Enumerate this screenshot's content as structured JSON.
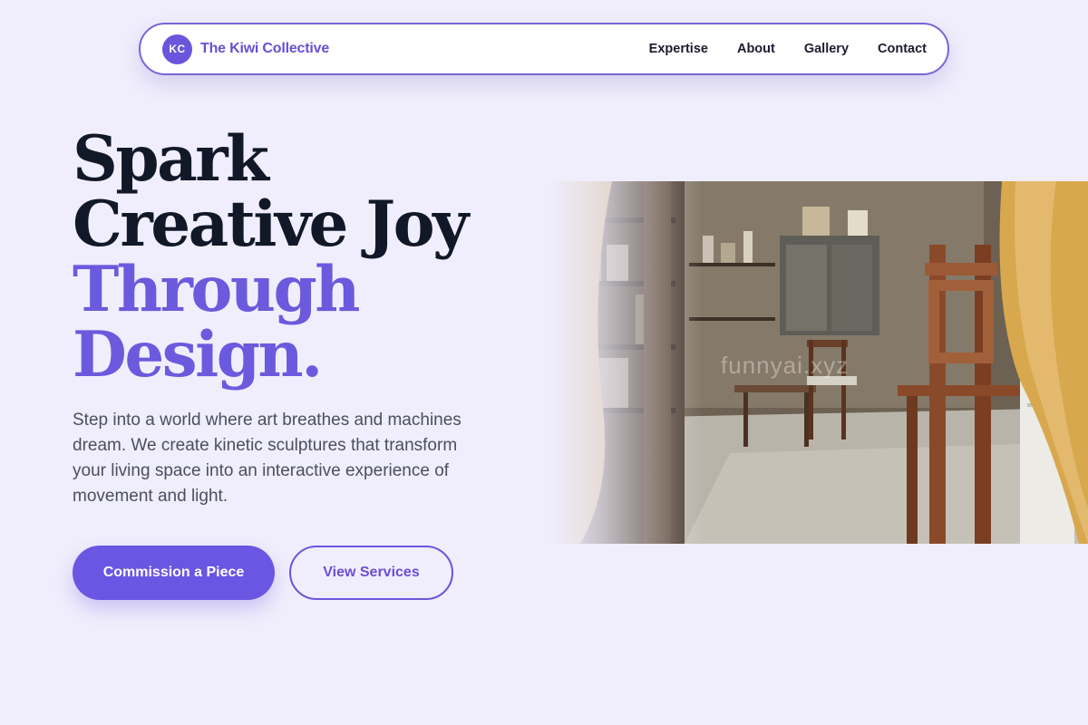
{
  "brand": {
    "initials": "KC",
    "name": "The Kiwi Collective"
  },
  "nav": {
    "links": [
      "Expertise",
      "About",
      "Gallery",
      "Contact"
    ]
  },
  "hero": {
    "headline_dark": [
      "Spark",
      "Creative Joy"
    ],
    "headline_accent": [
      "Through",
      "Design."
    ],
    "description": "Step into a world where art breathes and machines dream. We create kinetic sculptures that transform your living space into an interactive experience of movement and light.",
    "primary_cta": "Commission a Piece",
    "secondary_cta": "View Services",
    "image_watermark": "funnyai.xyz"
  },
  "colors": {
    "accent": "#6a56dc",
    "background": "#f0eefc",
    "headline": "#111827"
  }
}
